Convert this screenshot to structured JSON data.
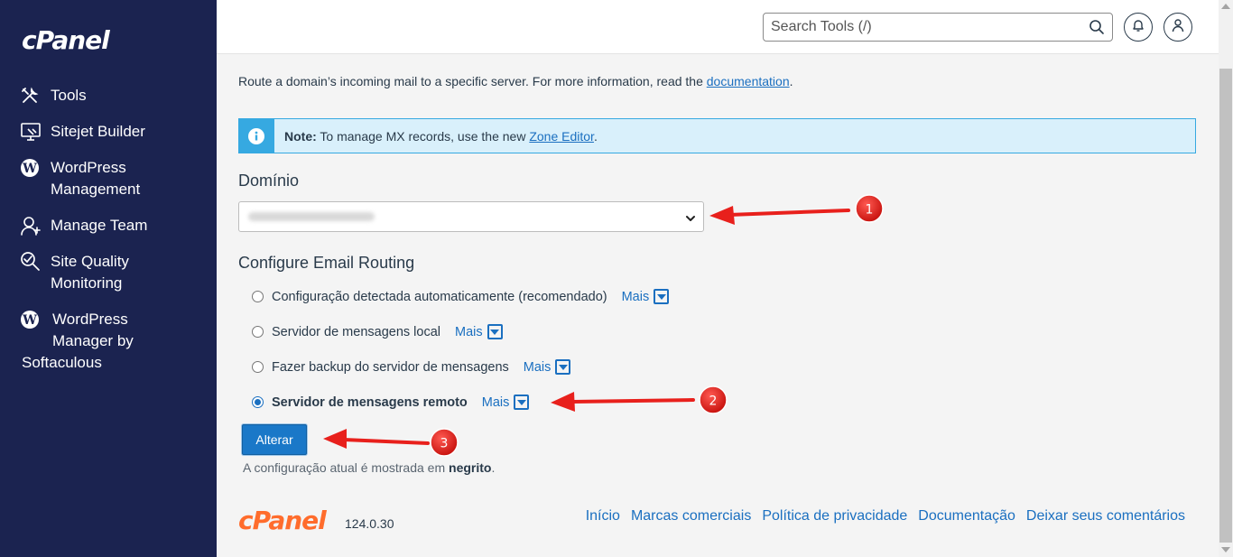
{
  "sidebar": {
    "logo": "cPanel",
    "items": [
      {
        "label": "Tools",
        "icon": "tools-icon"
      },
      {
        "label": "Sitejet Builder",
        "icon": "monitor-icon"
      },
      {
        "label": "WordPress Management",
        "icon": "wordpress-icon"
      },
      {
        "label": "Manage Team",
        "icon": "user-plus-icon"
      },
      {
        "label": "Site Quality Monitoring",
        "icon": "magnifier-icon"
      },
      {
        "label_line1": "WordPress",
        "label_line2": "Manager by",
        "label_line3": "Softaculous",
        "icon": "wordpress-icon"
      }
    ]
  },
  "topbar": {
    "search_placeholder": "Search Tools (/)"
  },
  "main": {
    "intro_text": "Route a domain’s incoming mail to a specific server. For more information, read the ",
    "intro_link": "documentation",
    "intro_end": ".",
    "note_label": "Note:",
    "note_text": " To manage MX records, use the new ",
    "note_link": "Zone Editor",
    "note_end": ".",
    "domain_heading": "Domínio",
    "routing_heading": "Configure Email Routing",
    "options": [
      {
        "label": "Configuração detectada automaticamente (recomendado)",
        "more": "Mais",
        "selected": false
      },
      {
        "label": "Servidor de mensagens local",
        "more": "Mais",
        "selected": false
      },
      {
        "label": "Fazer backup do servidor de mensagens",
        "more": "Mais",
        "selected": false
      },
      {
        "label": "Servidor de mensagens remoto",
        "more": "Mais",
        "selected": true
      }
    ],
    "submit_label": "Alterar",
    "hint_text": "A configuração atual é mostrada em ",
    "hint_bold": "negrito",
    "hint_end": "."
  },
  "footer": {
    "logo": "cPanel",
    "version": "124.0.30",
    "links": [
      "Início",
      "Marcas comerciais",
      "Política de privacidade",
      "Documentação",
      "Deixar seus comentários"
    ]
  },
  "annotations": {
    "markers": [
      "1",
      "2",
      "3"
    ],
    "color": "#e8201c"
  }
}
